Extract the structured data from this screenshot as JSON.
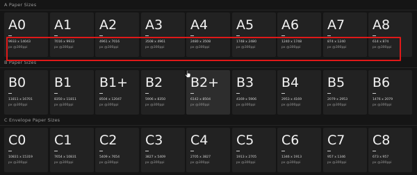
{
  "sections": [
    {
      "title": "A Paper Sizes",
      "tiles": [
        {
          "name": "A0",
          "dims": "9933 x 14043",
          "res": "px @300ppi"
        },
        {
          "name": "A1",
          "dims": "7016 x 9933",
          "res": "px @300ppi"
        },
        {
          "name": "A2",
          "dims": "4961 x 7016",
          "res": "px @300ppi"
        },
        {
          "name": "A3",
          "dims": "3508 x 4961",
          "res": "px @300ppi"
        },
        {
          "name": "A4",
          "dims": "2480 x 3508",
          "res": "px @300ppi"
        },
        {
          "name": "A5",
          "dims": "1748 x 2480",
          "res": "px @300ppi"
        },
        {
          "name": "A6",
          "dims": "1240 x 1748",
          "res": "px @300ppi"
        },
        {
          "name": "A7",
          "dims": "874 x 1240",
          "res": "px @300ppi"
        },
        {
          "name": "A8",
          "dims": "614 x 874",
          "res": "px @300ppi"
        }
      ]
    },
    {
      "title": "B Paper Sizes",
      "tiles": [
        {
          "name": "B0",
          "dims": "11811 x 16701",
          "res": "px @300ppi"
        },
        {
          "name": "B1",
          "dims": "8350 x 11811",
          "res": "px @300ppi"
        },
        {
          "name": "B1+",
          "dims": "8504 x 12047",
          "res": "px @300ppi"
        },
        {
          "name": "B2",
          "dims": "5906 x 8350",
          "res": "px @300ppi"
        },
        {
          "name": "B2+",
          "dims": "6142 x 8504",
          "res": "px @300ppi"
        },
        {
          "name": "B3",
          "dims": "4169 x 5906",
          "res": "px @300ppi"
        },
        {
          "name": "B4",
          "dims": "2953 x 4169",
          "res": "px @300ppi"
        },
        {
          "name": "B5",
          "dims": "2079 x 2953",
          "res": "px @300ppi"
        },
        {
          "name": "B6",
          "dims": "1476 x 2079",
          "res": "px @300ppi"
        }
      ]
    },
    {
      "title": "C Envelope Paper Sizes",
      "tiles": [
        {
          "name": "C0",
          "dims": "10831 x 15319",
          "res": "px @300ppi"
        },
        {
          "name": "C1",
          "dims": "7654 x 10831",
          "res": "px @300ppi"
        },
        {
          "name": "C2",
          "dims": "5409 x 7654",
          "res": "px @300ppi"
        },
        {
          "name": "C3",
          "dims": "3827 x 5409",
          "res": "px @300ppi"
        },
        {
          "name": "C4",
          "dims": "2705 x 3827",
          "res": "px @300ppi"
        },
        {
          "name": "C5",
          "dims": "1913 x 2705",
          "res": "px @300ppi"
        },
        {
          "name": "C6",
          "dims": "1346 x 1913",
          "res": "px @300ppi"
        },
        {
          "name": "C7",
          "dims": "957 x 1346",
          "res": "px @300ppi"
        },
        {
          "name": "C8",
          "dims": "673 x 957",
          "res": "px @300ppi"
        }
      ]
    }
  ],
  "colors": {
    "background": "#151515",
    "tile": "#222222",
    "tile_hover": "#2d2d2d",
    "highlight": "#e01919"
  },
  "icons": {
    "cursor": "hand-pointer-icon"
  }
}
